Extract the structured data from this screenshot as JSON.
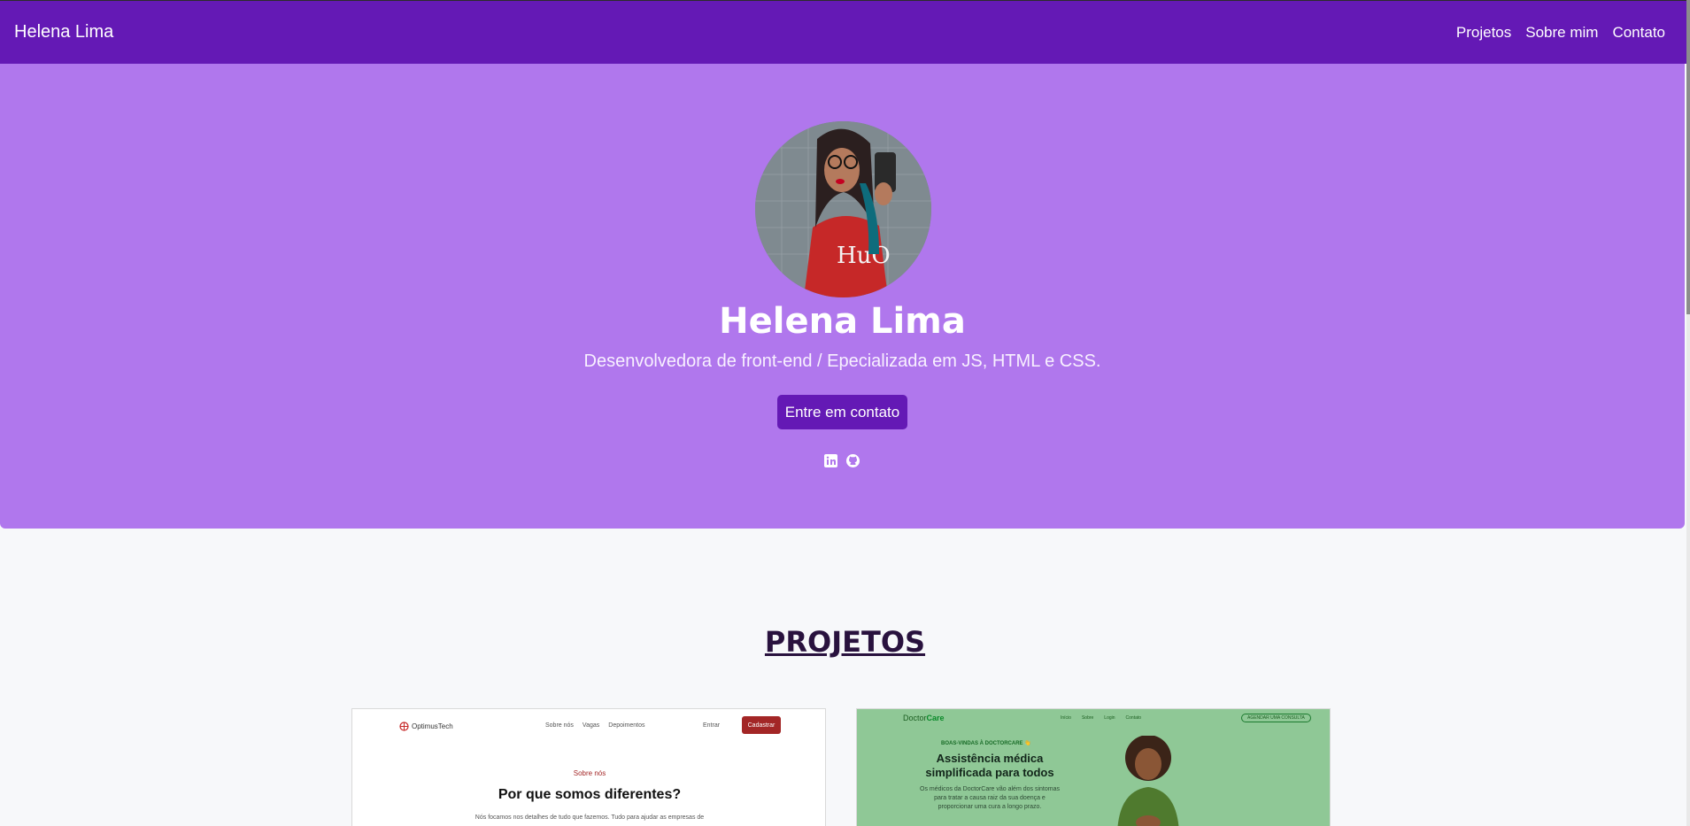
{
  "navbar": {
    "brand": "Helena Lima",
    "links": [
      "Projetos",
      "Sobre mim",
      "Contato"
    ]
  },
  "hero": {
    "name": "Helena Lima",
    "subtitle": "Desenvolvedora de front-end / Epecializada em JS, HTML e CSS.",
    "cta_label": "Entre em contato",
    "social_icons": [
      "linkedin-icon",
      "github-icon"
    ]
  },
  "projects": {
    "title": "PROJETOS",
    "cards": [
      {
        "logo": "OptimusTech",
        "nav": [
          "Sobre nós",
          "Vagas",
          "Depoimentos"
        ],
        "enter": "Entrar",
        "signup": "Cadastrar",
        "kicker": "Sobre nós",
        "heading": "Por que somos diferentes?",
        "body": "Nós focamos nos detalhes de tudo que fazemos. Tudo para ajudar as empresas de"
      },
      {
        "logo_part1": "Doctor",
        "logo_part2": "Care",
        "nav": [
          "Início",
          "Sobre",
          "Login",
          "Contato"
        ],
        "button": "AGENDAR UMA CONSULTA",
        "kicker": "BOAS-VINDAS À DOCTORCARE 👋",
        "heading": "Assistência médica simplificada para todos",
        "body": "Os médicos da DoctorCare vão além dos sintomas para tratar a causa raiz da sua doença e proporcionar uma cura a longo prazo."
      }
    ]
  },
  "colors": {
    "navbar": "#6419b5",
    "hero": "#b077ed",
    "button": "#6419b5",
    "projects_title": "#29123e"
  }
}
